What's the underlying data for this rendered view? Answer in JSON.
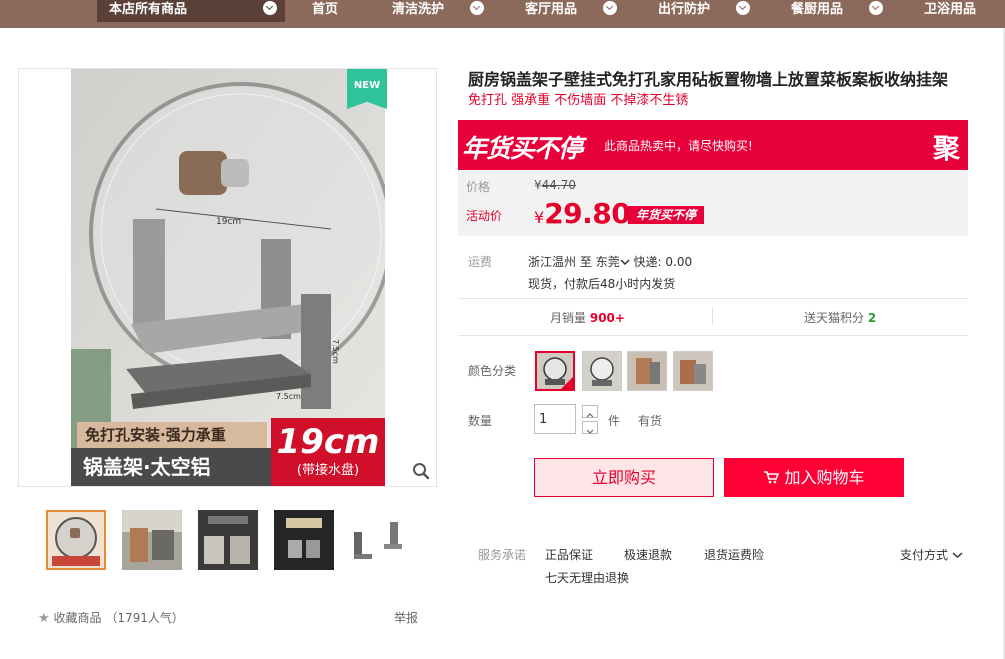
{
  "nav": {
    "store_all": "本店所有商品",
    "items": [
      "首页",
      "清洁洗护",
      "客厅用品",
      "出行防护",
      "餐厨用品",
      "卫浴用品"
    ]
  },
  "gallery": {
    "badge": "NEW",
    "main_banner_line1": "免打孔安装·强力承重",
    "main_banner_line2": "锅盖架·太空铝",
    "main_banner_size": "19cm",
    "main_banner_note": "(带接水盘)",
    "dim_width": "19cm",
    "dim_height": "7.5cm",
    "dim_depth": "7.5cm",
    "favorite_label": "收藏商品",
    "favorite_count": "（1791人气）",
    "report_label": "举报"
  },
  "product": {
    "title": "厨房锅盖架子壁挂式免打孔家用砧板置物墙上放置菜板案板收纳挂架",
    "subtitle": "免打孔 强承重 不伤墙面 不掉漆不生锈"
  },
  "promo": {
    "main": "年货买不停",
    "note": "此商品热卖中，请尽快购买!",
    "tag": "聚"
  },
  "price": {
    "label": "价格",
    "original_currency": "¥",
    "original": "44.70",
    "activity_label": "活动价",
    "activity_currency": "¥",
    "activity": "29.80",
    "activity_tag": "年货买不停"
  },
  "shipping": {
    "label": "运费",
    "from": "浙江温州",
    "to_word": "至",
    "to": "东莞",
    "express": "快递: 0.00",
    "stock_note": "现货，付款后48小时内发货"
  },
  "stats": {
    "monthly_label": "月销量",
    "monthly_value": "900+",
    "points_label": "送天猫积分",
    "points_value": "2"
  },
  "options": {
    "color_label": "颜色分类",
    "quantity_label": "数量",
    "quantity_value": "1",
    "unit": "件",
    "stock": "有货"
  },
  "actions": {
    "buy": "立即购买",
    "cart": "加入购物车"
  },
  "service": {
    "label": "服务承诺",
    "items": [
      "正品保证",
      "极速退款",
      "退货运费险",
      "七天无理由退换"
    ],
    "payment": "支付方式"
  },
  "colors": {
    "accent": "#e5002b",
    "nav_bg": "#8c6a5b",
    "promo_bg": "#e8003a"
  }
}
